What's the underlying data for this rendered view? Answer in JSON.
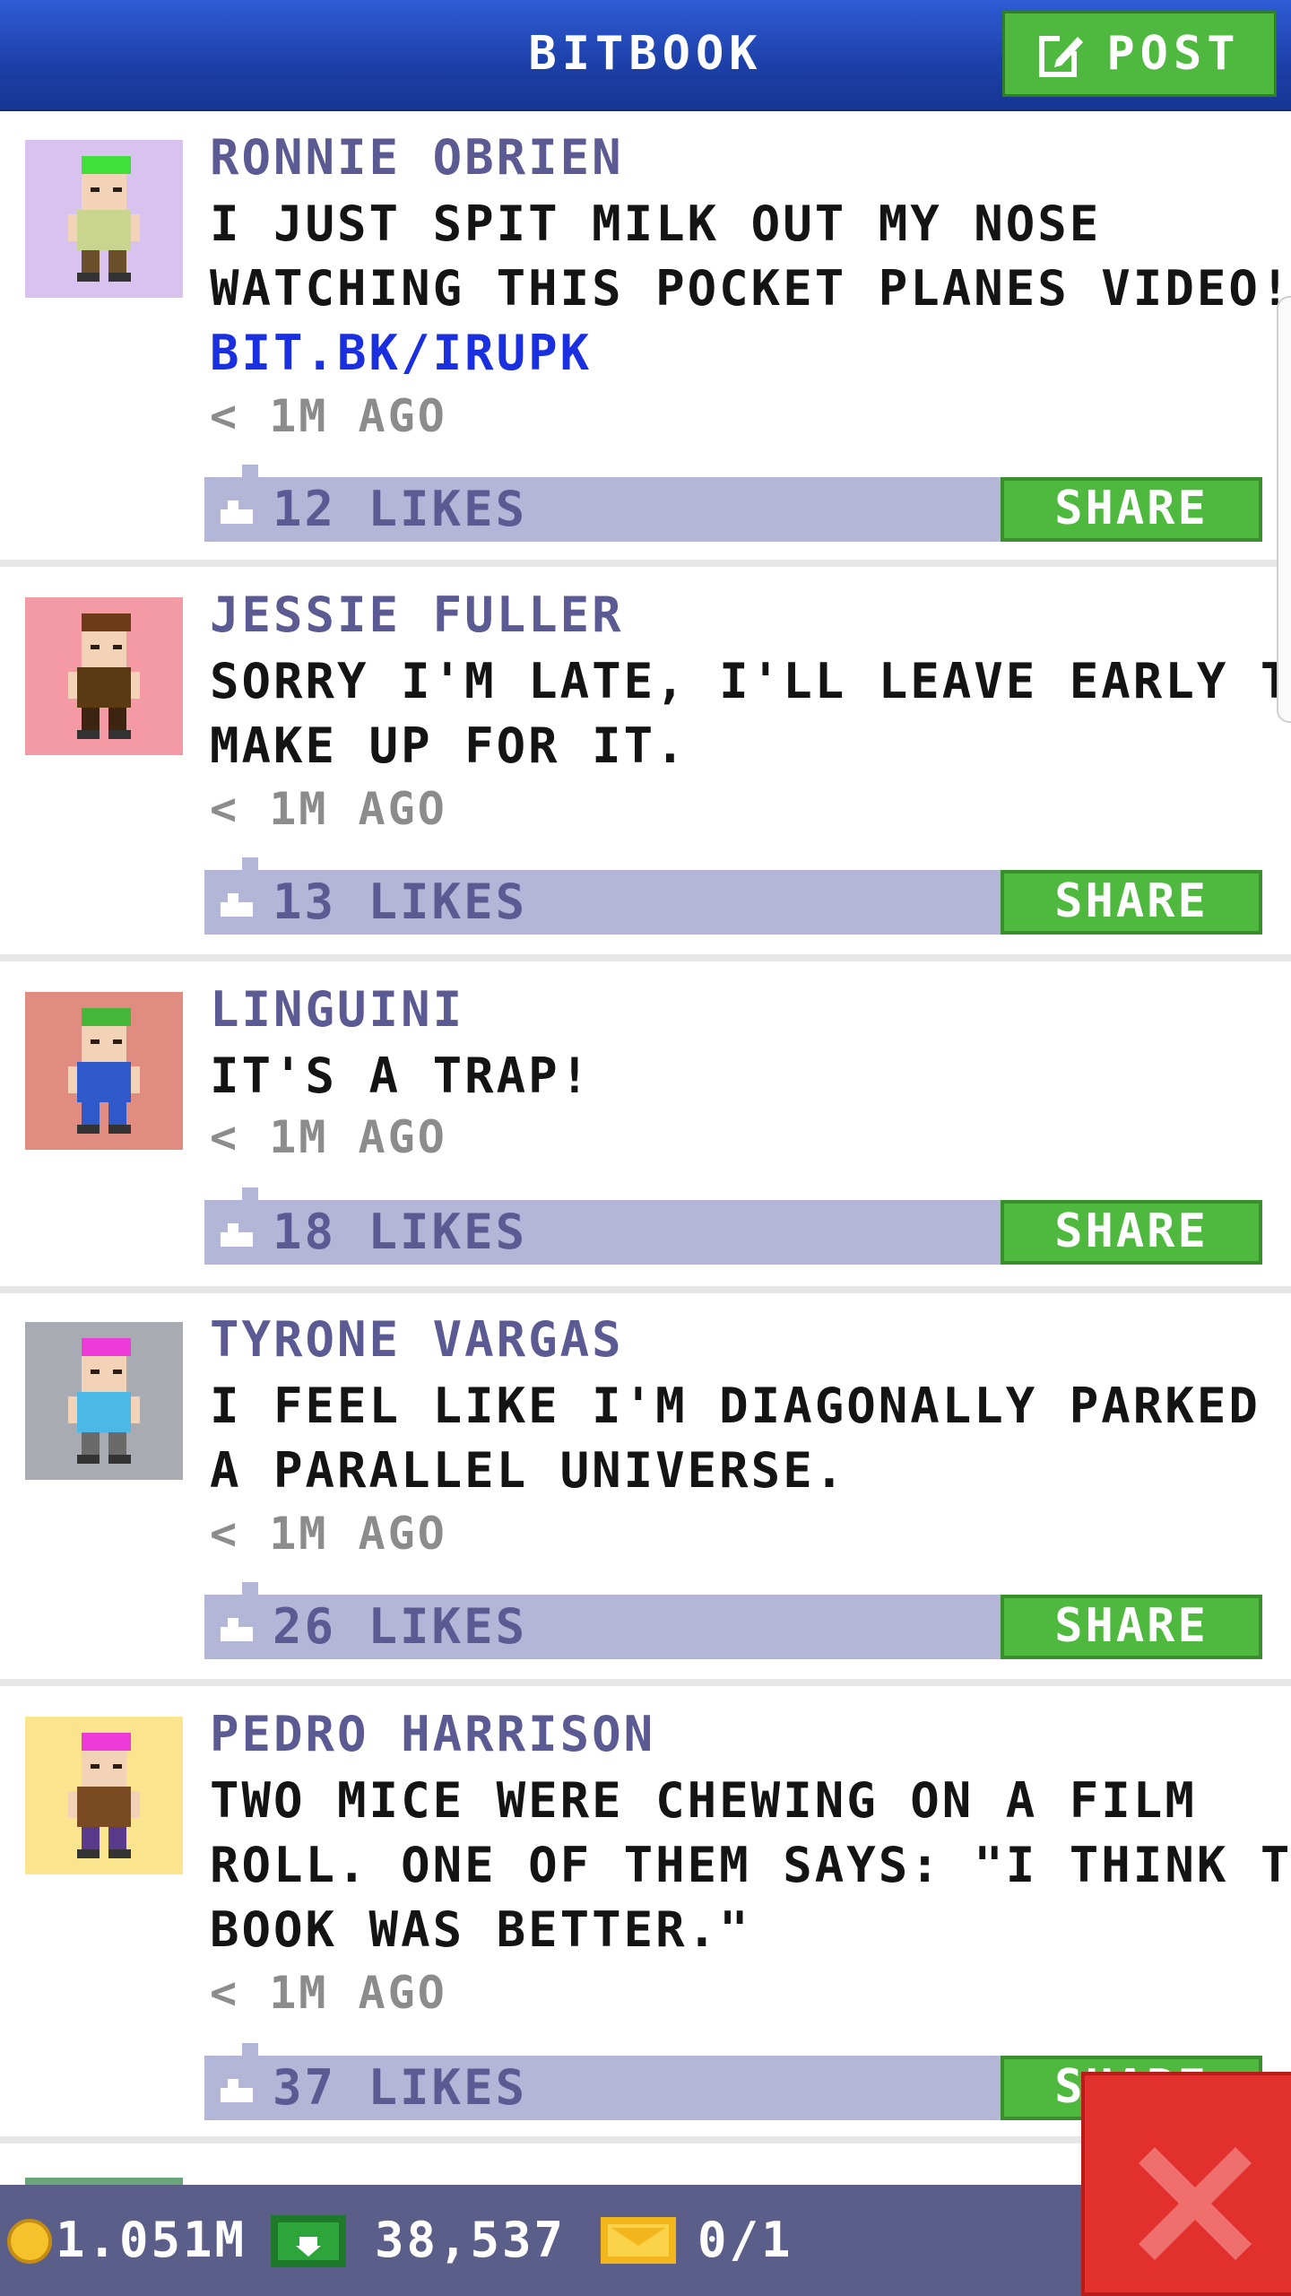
{
  "header": {
    "title": "BITBOOK",
    "post_label": "POST"
  },
  "posts": [
    {
      "author": "RONNIE OBRIEN",
      "lines": [
        "I JUST SPIT MILK OUT MY NOSE",
        "WATCHING THIS POCKET PLANES VIDEO!"
      ],
      "link": "BIT.BK/IRUPK",
      "time": "< 1M AGO",
      "likes": "12 LIKES",
      "share": "SHARE",
      "avatar_bg": "#d8c2ee",
      "hair": "#3fe03a",
      "shirt": "#c9d58f",
      "pants": "#6b4f2a"
    },
    {
      "author": "JESSIE FULLER",
      "lines": [
        "SORRY I'M LATE, I'LL LEAVE EARLY TO",
        "MAKE UP FOR IT."
      ],
      "time": "< 1M AGO",
      "likes": "13 LIKES",
      "share": "SHARE",
      "avatar_bg": "#f39aa4",
      "hair": "#6e3a18",
      "shirt": "#5a3a12",
      "pants": "#3c2410"
    },
    {
      "author": "LINGUINI",
      "lines": [
        "IT'S A TRAP!"
      ],
      "time": "< 1M AGO",
      "likes": "18 LIKES",
      "share": "SHARE",
      "avatar_bg": "#e08c80",
      "hair": "#45b83a",
      "shirt": "#2f58c8",
      "pants": "#2f58c8"
    },
    {
      "author": "TYRONE VARGAS",
      "lines": [
        "I FEEL LIKE I'M DIAGONALLY PARKED IN",
        "A PARALLEL UNIVERSE."
      ],
      "time": "< 1M AGO",
      "likes": "26 LIKES",
      "share": "SHARE",
      "avatar_bg": "#a9abb3",
      "hair": "#ee3ad8",
      "shirt": "#4cb8e8",
      "pants": "#6a6a6a"
    },
    {
      "author": "PEDRO HARRISON",
      "lines": [
        "TWO MICE WERE CHEWING ON A FILM",
        "ROLL. ONE OF THEM SAYS: \"I THINK THE",
        "BOOK WAS BETTER.\""
      ],
      "time": "< 1M AGO",
      "likes": "37 LIKES",
      "share": "SHARE",
      "avatar_bg": "#fbe48e",
      "hair": "#ee3ad8",
      "shirt": "#7a4a22",
      "pants": "#5a3a8a"
    }
  ],
  "bottom_bar": {
    "coins": "1.051M",
    "cash": "38,537",
    "tickets": "0/1"
  },
  "colors": {
    "header": "#1c3fa8",
    "green": "#4fb83e",
    "likes_bar": "#b4b6d7",
    "name": "#5c5a92",
    "link": "#1a2fe0",
    "close": "#e2302d"
  }
}
